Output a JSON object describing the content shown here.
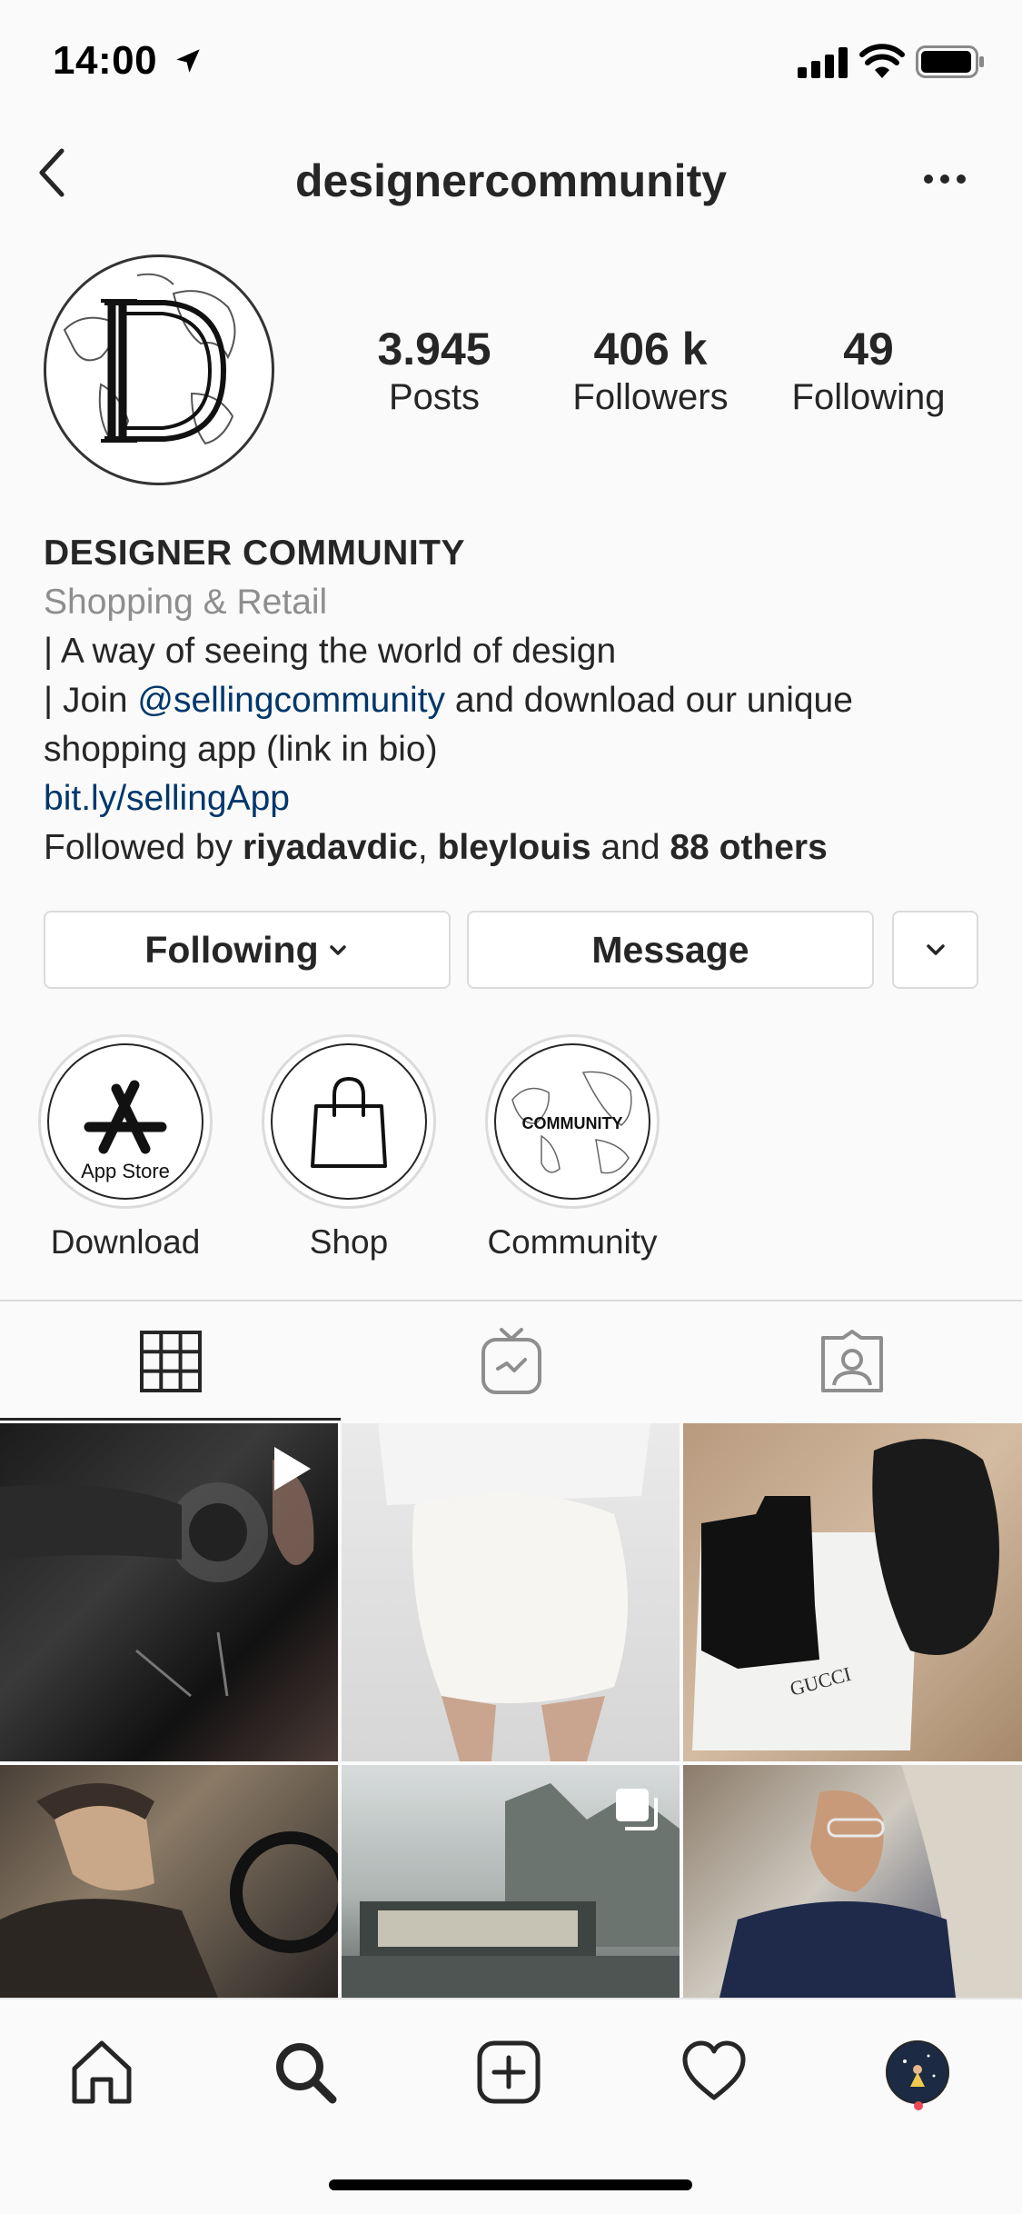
{
  "status_bar": {
    "time": "14:00"
  },
  "nav": {
    "username": "designercommunity"
  },
  "profile": {
    "stats": [
      {
        "value": "3.945",
        "label": "Posts"
      },
      {
        "value": "406 k",
        "label": "Followers"
      },
      {
        "value": "49",
        "label": "Following"
      }
    ],
    "name": "DESIGNER COMMUNITY",
    "category": "Shopping & Retail",
    "bio_line1": "| A way of seeing the world of design",
    "bio_line2_prefix": "| Join ",
    "bio_mention": "@sellingcommunity",
    "bio_line2_suffix": " and download our unique",
    "bio_line3": "shopping app (link in bio)",
    "link": "bit.ly/sellingApp",
    "followed_prefix": "Followed by ",
    "followed_user1": "riyadavdic",
    "followed_sep": ", ",
    "followed_user2": "bleylouis",
    "followed_and": " and ",
    "followed_others": "88 others"
  },
  "actions": {
    "following_label": "Following",
    "message_label": "Message"
  },
  "highlights": [
    {
      "label": "Download",
      "cover_text": "App Store"
    },
    {
      "label": "Shop"
    },
    {
      "label": "Community",
      "cover_text": "COMMUNITY"
    }
  ],
  "tabs": [
    "grid-icon",
    "igtv-icon",
    "tagged-icon"
  ],
  "bottom_nav": [
    "home-icon",
    "search-icon",
    "add-icon",
    "heart-icon",
    "profile-avatar"
  ]
}
